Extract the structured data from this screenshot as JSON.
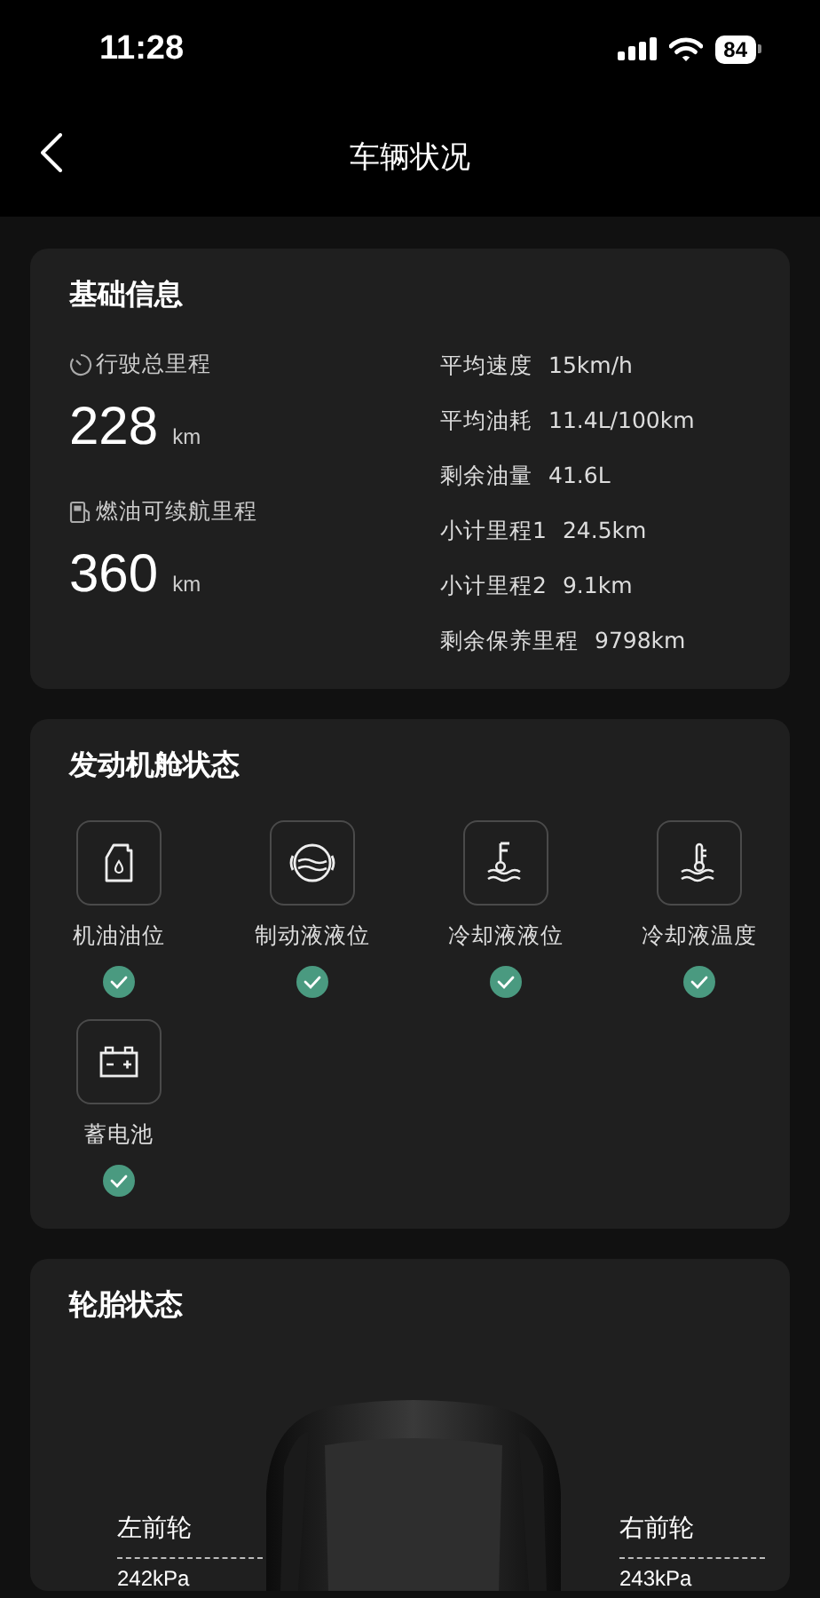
{
  "status_bar": {
    "time": "11:28",
    "battery": "84"
  },
  "header": {
    "title": "车辆状况"
  },
  "basic_info": {
    "title": "基础信息",
    "primary": [
      {
        "kind": "clock",
        "label": "行驶总里程",
        "value": "228",
        "unit": "km"
      },
      {
        "kind": "fuel",
        "label": "燃油可续航里程",
        "value": "360",
        "unit": "km"
      }
    ],
    "stats": [
      {
        "label": "平均速度",
        "value": "15km/h"
      },
      {
        "label": "平均油耗",
        "value": "11.4L/100km"
      },
      {
        "label": "剩余油量",
        "value": "41.6L"
      },
      {
        "label": "小计里程1",
        "value": "24.5km"
      },
      {
        "label": "小计里程2",
        "value": "9.1km"
      },
      {
        "label": "剩余保养里程",
        "value": "9798km"
      }
    ]
  },
  "engine": {
    "title": "发动机舱状态",
    "items": [
      {
        "kind": "oil",
        "label": "机油油位",
        "ok": true
      },
      {
        "kind": "brake",
        "label": "制动液液位",
        "ok": true
      },
      {
        "kind": "coolant_level",
        "label": "冷却液液位",
        "ok": true
      },
      {
        "kind": "coolant_temp",
        "label": "冷却液温度",
        "ok": true
      },
      {
        "kind": "battery",
        "label": "蓄电池",
        "ok": true
      }
    ]
  },
  "tires": {
    "title": "轮胎状态",
    "wheels": [
      {
        "label": "左前轮",
        "pressure": "242kPa"
      },
      {
        "label": "右前轮",
        "pressure": "243kPa"
      }
    ]
  }
}
